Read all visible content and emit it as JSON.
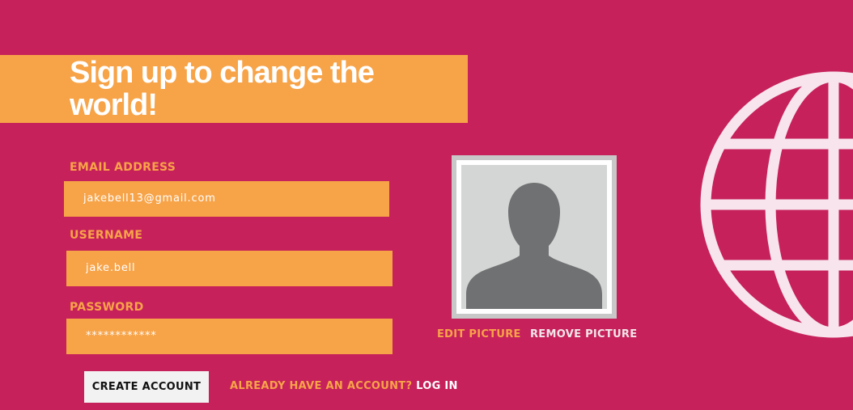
{
  "header": {
    "title": "Sign up to change the world!"
  },
  "form": {
    "email": {
      "label": "EMAIL ADDRESS",
      "value": "jakebell13@gmail.com"
    },
    "username": {
      "label": "USERNAME",
      "value": "jake.bell"
    },
    "password": {
      "label": "PASSWORD",
      "value": "************"
    },
    "create_button": "CREATE ACCOUNT",
    "login_prompt": "ALREADY HAVE AN ACCOUNT?",
    "login_link": "LOG IN"
  },
  "profile_picture": {
    "edit_label": "EDIT PICTURE",
    "remove_label": "REMOVE PICTURE"
  },
  "icons": {
    "avatar": "person-silhouette-icon",
    "globe": "globe-icon"
  },
  "colors": {
    "background": "#c6215a",
    "accent": "#f7a348",
    "text": "#ffffff",
    "globe": "#f7e4ec"
  }
}
